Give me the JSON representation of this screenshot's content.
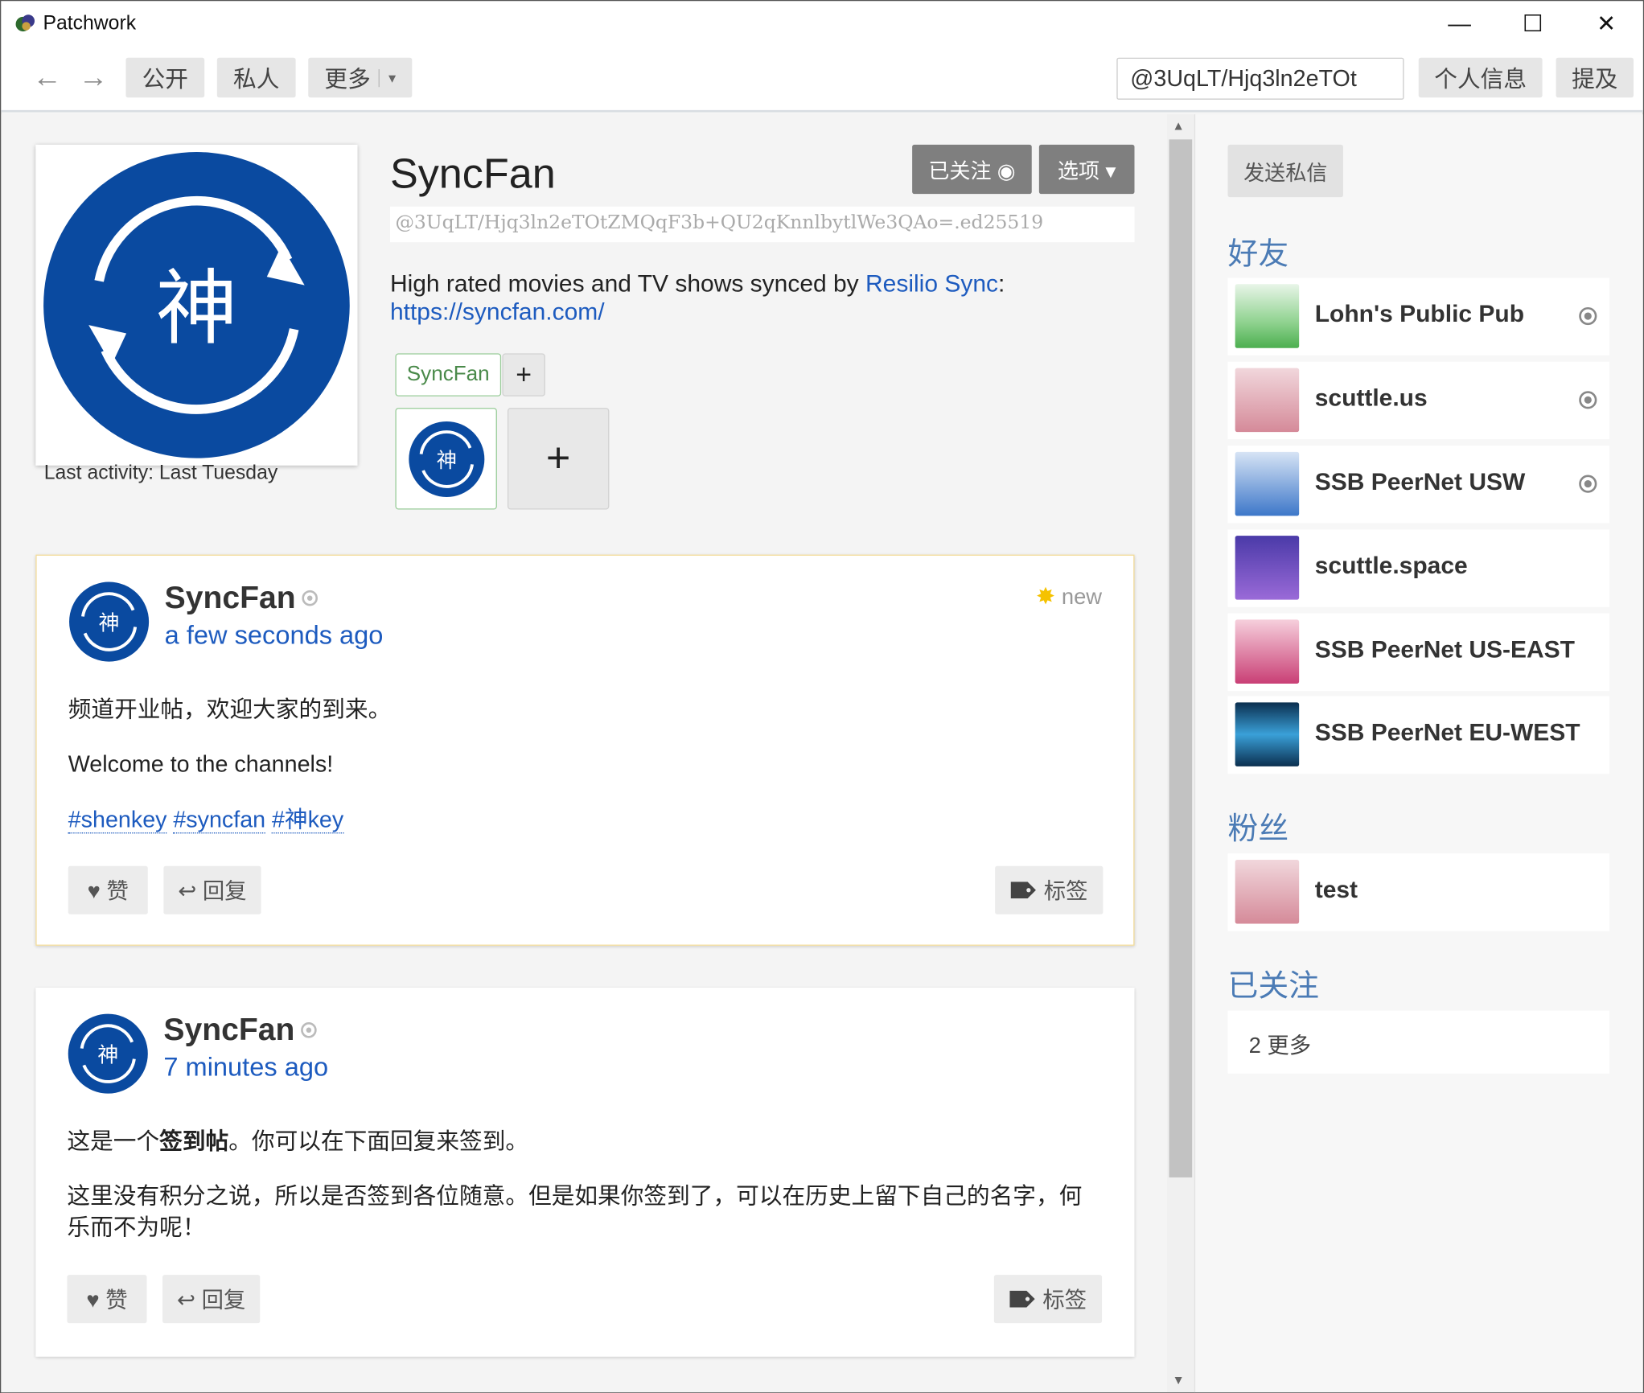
{
  "window": {
    "title": "Patchwork",
    "minimize": "—",
    "maximize": "☐",
    "close": "✕"
  },
  "nav": {
    "back": "←",
    "forward": "→",
    "public": "公开",
    "private": "私人",
    "more": "更多",
    "more_caret": "▾",
    "search_value": "@3UqLT/Hjq3ln2eTOt",
    "profile": "个人信息",
    "mentions": "提及"
  },
  "profile": {
    "name": "SyncFan",
    "id": "@3UqLT/Hjq3ln2eTOtZMQqF3b+QU2qKnnlbytlWe3QAo=.ed25519",
    "last_activity": "Last activity: Last Tuesday",
    "following_label": "已关注 ◉",
    "options_label": "选项 ▾",
    "desc_prefix": "High rated movies and TV shows synced by ",
    "desc_link": "Resilio Sync",
    "desc_colon": ":",
    "url": "https://syncfan.com/",
    "name_chip": "SyncFan",
    "plus": "+",
    "avatar_glyph": "神"
  },
  "posts": [
    {
      "author": "SyncFan",
      "time": "a few seconds ago",
      "new_label": "new",
      "new_icon": "✸",
      "line1": "频道开业帖，欢迎大家的到来。",
      "line2": "Welcome to the channels!",
      "tags": [
        "#shenkey",
        "#syncfan",
        "#神key"
      ],
      "like": "♥ 赞",
      "reply": "↩ 回复",
      "tag_btn": "标签"
    },
    {
      "author": "SyncFan",
      "time": "7 minutes ago",
      "line1_a": "这是一个",
      "line1_b": "签到帖",
      "line1_c": "。你可以在下面回复来签到。",
      "line2": "这里没有积分之说，所以是否签到各位随意。但是如果你签到了，可以在历史上留下自己的名字，何乐而不为呢！",
      "like": "♥ 赞",
      "reply": "↩ 回复",
      "tag_btn": "标签"
    }
  ],
  "sidebar": {
    "dm_button": "发送私信",
    "friends_heading": "好友",
    "friends": [
      {
        "name": "Lohn's Public Pub",
        "color": "#8fd28f"
      },
      {
        "name": "scuttle.us",
        "color": "#e0a9b2"
      },
      {
        "name": "SSB PeerNet USW",
        "color": "#7aa5dd"
      },
      {
        "name": "scuttle.space",
        "color": "#8a6ad3"
      },
      {
        "name": "SSB PeerNet US-EAST",
        "color": "#e27aa0"
      },
      {
        "name": "SSB PeerNet EU-WEST",
        "color": "#2a7fc0"
      }
    ],
    "followers_heading": "粉丝",
    "followers": [
      {
        "name": "test",
        "color": "#e0a9b2"
      }
    ],
    "following_heading": "已关注",
    "following_more": "2 更多"
  },
  "colors": {
    "accent_blue": "#1d5bbf",
    "heading_blue": "#4b7bb5",
    "logo_blue": "#0a4aa0"
  }
}
